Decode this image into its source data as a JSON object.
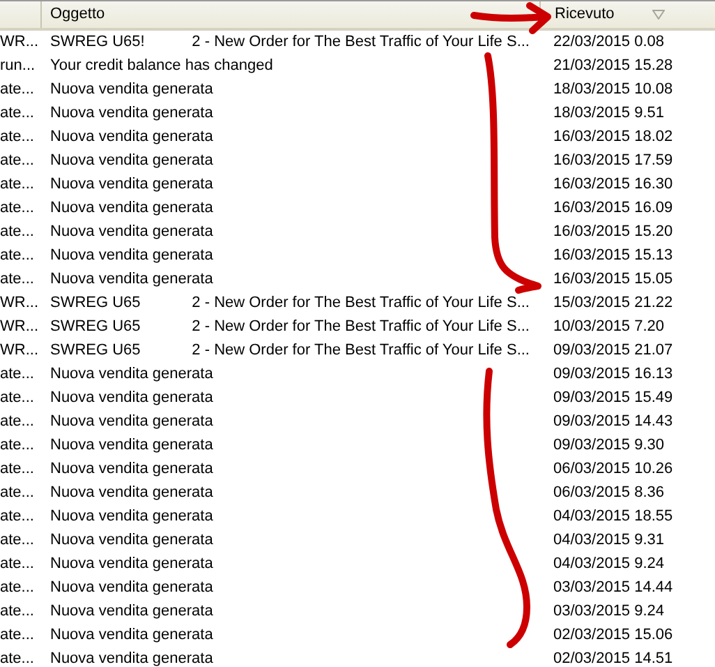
{
  "table": {
    "columns": [
      {},
      {
        "label": "Oggetto"
      },
      {
        "label": "Ricevuto",
        "sorted": true
      }
    ],
    "rows": [
      {
        "sender": "WR...",
        "subject": "SWREG U65!",
        "subject_tail": "2 - New Order for The Best Traffic of Your Life S...",
        "received": "22/03/2015 0.08"
      },
      {
        "sender": "run...",
        "subject": "Your credit balance has changed",
        "received": "21/03/2015 15.28"
      },
      {
        "sender": "ate...",
        "subject": "Nuova vendita generata",
        "received": "18/03/2015 10.08"
      },
      {
        "sender": "ate...",
        "subject": "Nuova vendita generata",
        "received": "18/03/2015 9.51"
      },
      {
        "sender": "ate...",
        "subject": "Nuova vendita generata",
        "received": "16/03/2015 18.02"
      },
      {
        "sender": "ate...",
        "subject": "Nuova vendita generata",
        "received": "16/03/2015 17.59"
      },
      {
        "sender": "ate...",
        "subject": "Nuova vendita generata",
        "received": "16/03/2015 16.30"
      },
      {
        "sender": "ate...",
        "subject": "Nuova vendita generata",
        "received": "16/03/2015 16.09"
      },
      {
        "sender": "ate...",
        "subject": "Nuova vendita generata",
        "received": "16/03/2015 15.20"
      },
      {
        "sender": "ate...",
        "subject": "Nuova vendita generata",
        "received": "16/03/2015 15.13"
      },
      {
        "sender": "ate...",
        "subject": "Nuova vendita generata",
        "received": "16/03/2015 15.05"
      },
      {
        "sender": "WR...",
        "subject": "SWREG U65",
        "subject_tail": "2 - New Order for The Best Traffic of Your Life S...",
        "received": "15/03/2015 21.22"
      },
      {
        "sender": "WR...",
        "subject": "SWREG U65",
        "subject_tail": "2 - New Order for The Best Traffic of Your Life S...",
        "received": "10/03/2015 7.20"
      },
      {
        "sender": "WR...",
        "subject": "SWREG U65",
        "subject_tail": "2 - New Order for The Best Traffic of Your Life S...",
        "received": "09/03/2015 21.07"
      },
      {
        "sender": "ate...",
        "subject": "Nuova vendita generata",
        "received": "09/03/2015 16.13"
      },
      {
        "sender": "ate...",
        "subject": "Nuova vendita generata",
        "received": "09/03/2015 15.49"
      },
      {
        "sender": "ate...",
        "subject": "Nuova vendita generata",
        "received": "09/03/2015 14.43"
      },
      {
        "sender": "ate...",
        "subject": "Nuova vendita generata",
        "received": "09/03/2015 9.30"
      },
      {
        "sender": "ate...",
        "subject": "Nuova vendita generata",
        "received": "06/03/2015 10.26"
      },
      {
        "sender": "ate...",
        "subject": "Nuova vendita generata",
        "received": "06/03/2015 8.36"
      },
      {
        "sender": "ate...",
        "subject": "Nuova vendita generata",
        "received": "04/03/2015 18.55"
      },
      {
        "sender": "ate...",
        "subject": "Nuova vendita generata",
        "received": "04/03/2015 9.31"
      },
      {
        "sender": "ate...",
        "subject": "Nuova vendita generata",
        "received": "04/03/2015 9.24"
      },
      {
        "sender": "ate...",
        "subject": "Nuova vendita generata",
        "received": "03/03/2015 14.44"
      },
      {
        "sender": "ate...",
        "subject": "Nuova vendita generata",
        "received": "03/03/2015 9.24"
      },
      {
        "sender": "ate...",
        "subject": "Nuova vendita generata",
        "received": "02/03/2015 15.06"
      },
      {
        "sender": "ate...",
        "subject": "Nuova vendita generata",
        "received": "02/03/2015 14.51"
      }
    ]
  }
}
